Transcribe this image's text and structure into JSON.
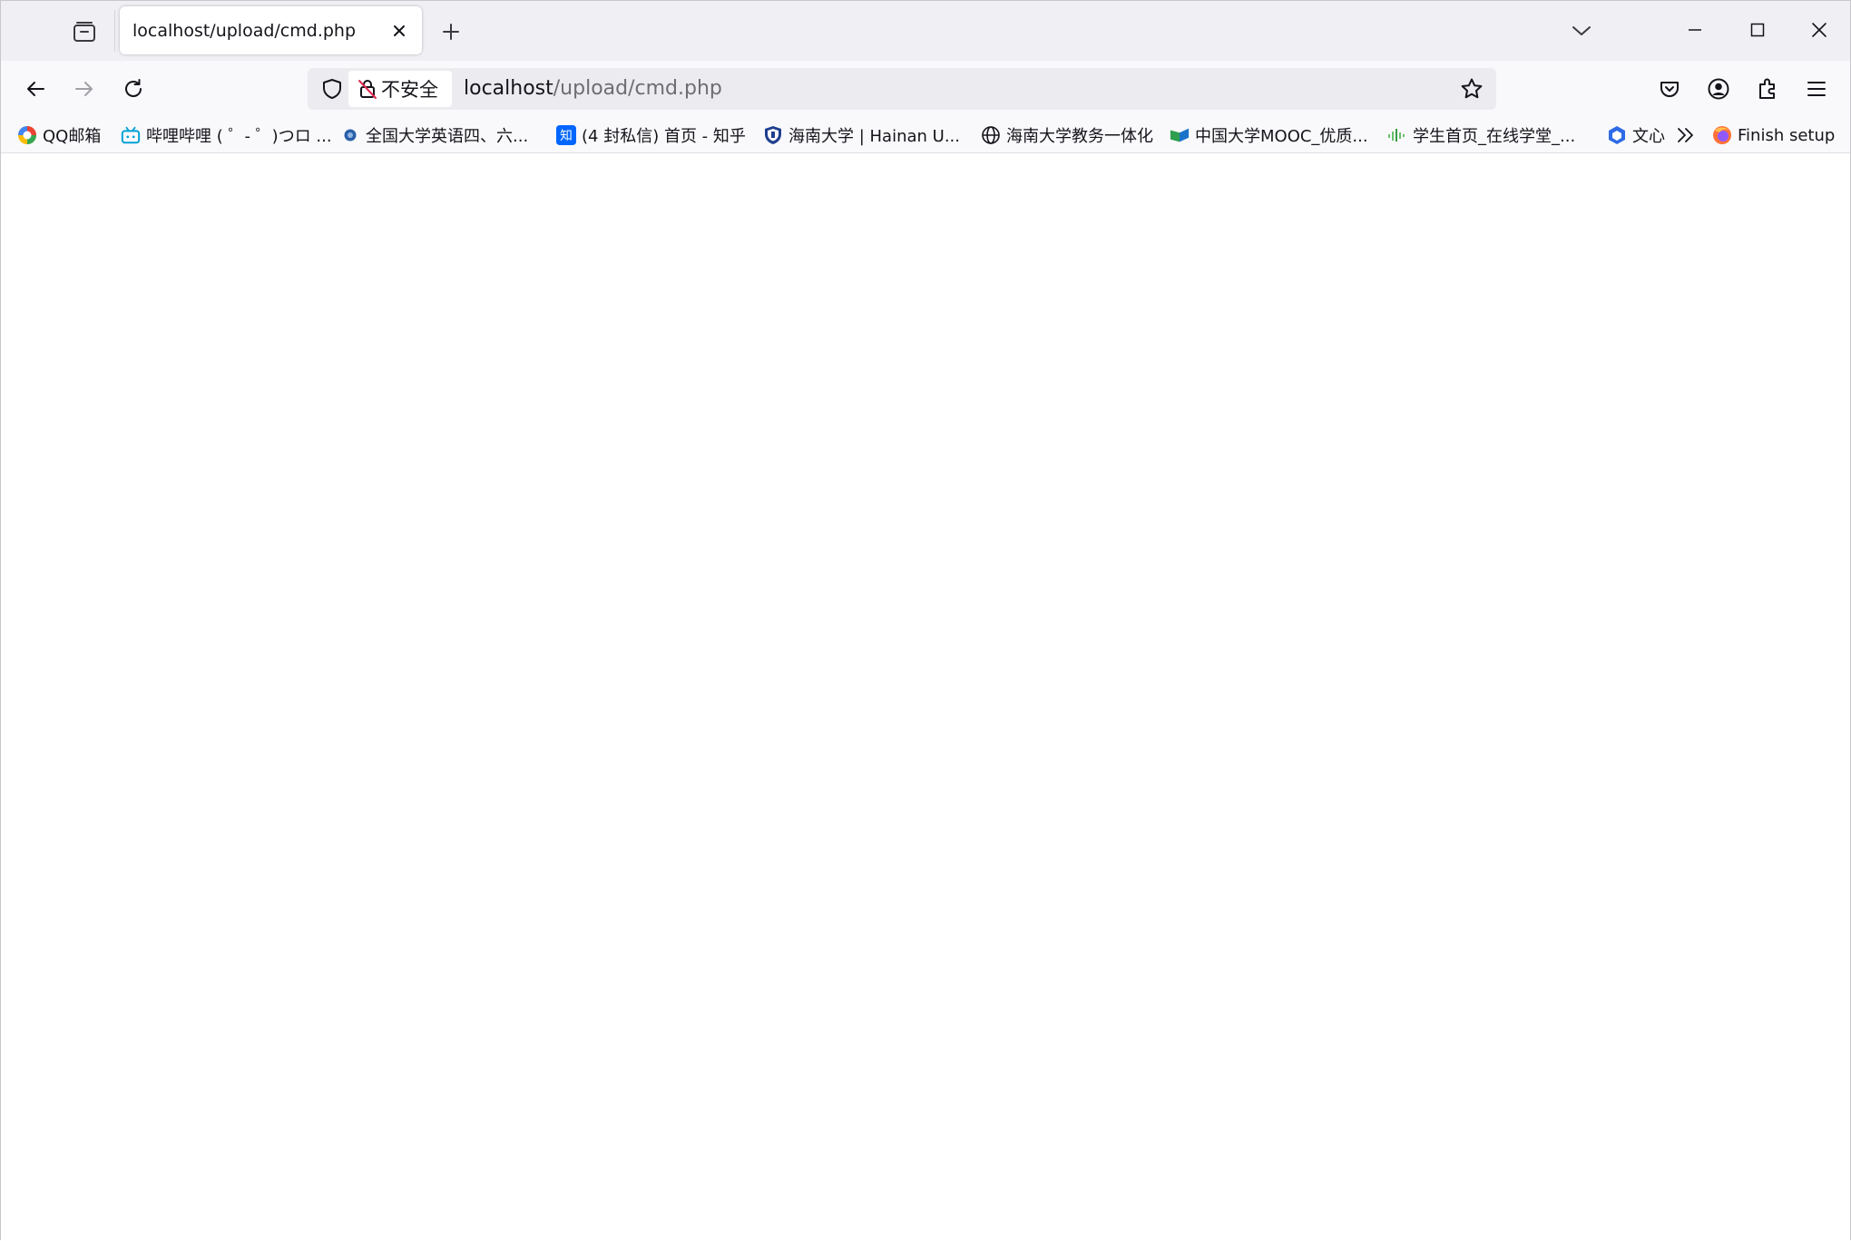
{
  "tab": {
    "title": "localhost/upload/cmd.php"
  },
  "urlbar": {
    "identity_label": "不安全",
    "url_host": "localhost",
    "url_path": "/upload/cmd.php"
  },
  "bookmarks": [
    {
      "label": "QQ邮箱",
      "icon": "qq-mail-icon"
    },
    {
      "label": "哔哩哔哩 ( ゜- ゜)つロ ...",
      "icon": "bilibili-icon"
    },
    {
      "label": "全国大学英语四、六...",
      "icon": "cet-icon"
    },
    {
      "label": "(4 封私信) 首页 - 知乎",
      "icon": "zhihu-icon"
    },
    {
      "label": "海南大学 | Hainan U...",
      "icon": "hainan-university-icon"
    },
    {
      "label": "海南大学教务一体化",
      "icon": "globe-icon"
    },
    {
      "label": "中国大学MOOC_优质...",
      "icon": "mooc-icon"
    },
    {
      "label": "学生首页_在线学堂_...",
      "icon": "xuetang-icon"
    },
    {
      "label": "文心",
      "icon": "wenxin-icon"
    }
  ],
  "bookmarks_overflow_label": "Finish setup",
  "colors": {
    "accent": "#0060df",
    "zhihu": "#0066ff",
    "bilibili": "#00a1d6",
    "tabstrip_bg": "#f0f0f4",
    "navbar_bg": "#f9f9fb"
  }
}
